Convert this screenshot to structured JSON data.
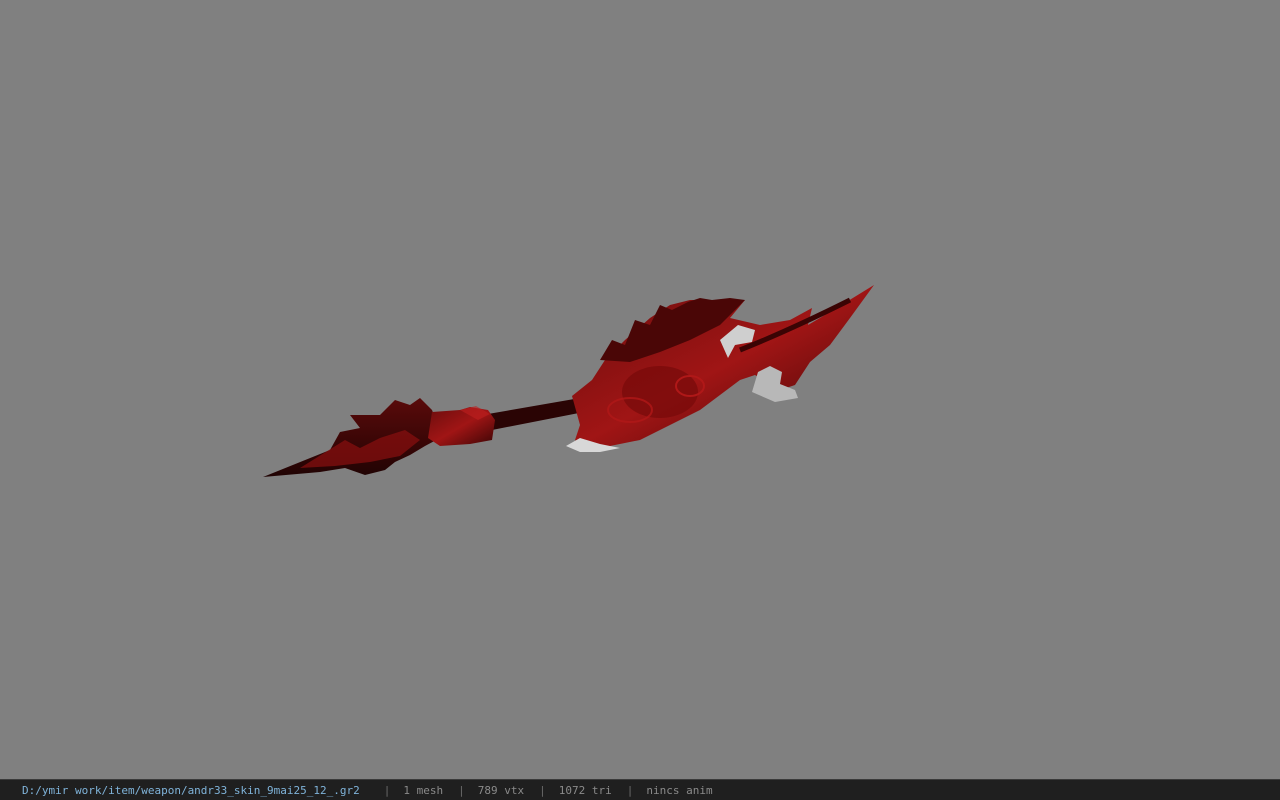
{
  "viewport": {
    "background": "#808080",
    "model_icon": "weapon-model-icon"
  },
  "statusbar": {
    "path": "D:/ymir work/item/weapon/andr33_skin_9mai25_12_.gr2",
    "separator": "|",
    "mesh": "1 mesh",
    "vtx": "789 vtx",
    "tri": "1072 tri",
    "anim": "nincs anim",
    "path_color": "#7fb3d9"
  }
}
